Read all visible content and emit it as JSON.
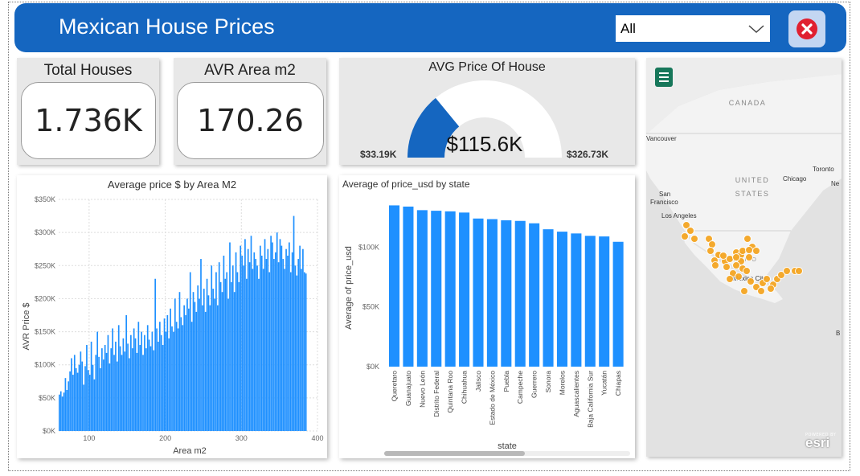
{
  "header": {
    "title": "Mexican House Prices",
    "filter_value": "All",
    "accent_color": "#1566c0",
    "close_icon": "close-circle-icon"
  },
  "kpis": {
    "total_houses": {
      "label": "Total Houses",
      "value": "1.736K"
    },
    "avr_area": {
      "label": "AVR Area m2",
      "value": "170.26"
    }
  },
  "gauge": {
    "title": "AVG Price Of House",
    "value_label": "$115.6K",
    "min_label": "$33.19K",
    "max_label": "$326.73K",
    "value": 115.6,
    "min": 33.19,
    "max": 326.73,
    "fill_color": "#1566c0"
  },
  "map": {
    "labels": [
      "CANADA",
      "Vancouver",
      "Toronto",
      "Chicago",
      "UNITED",
      "STATES",
      "Ne",
      "San",
      "Francisco",
      "Los Angeles",
      "MEXICO",
      "Mexico City",
      "B"
    ],
    "brand": "esri",
    "brand_small": "POWERED BY",
    "menu_icon": "hamburger-menu-icon",
    "marker_color": "#f5a623"
  },
  "chart_data": [
    {
      "type": "bar",
      "title": "Average price $ by Area M2",
      "xlabel": "Area m2",
      "ylabel": "AVR Price $",
      "x_ticks": [
        "100",
        "200",
        "300",
        "400"
      ],
      "y_ticks": [
        "$0K",
        "$50K",
        "$100K",
        "$150K",
        "$200K",
        "$250K",
        "$300K",
        "$350K"
      ],
      "xlim": [
        60,
        400
      ],
      "ylim": [
        0,
        350000
      ],
      "grid": true,
      "color": "#1e90ff",
      "x": [
        60,
        62,
        64,
        66,
        68,
        70,
        72,
        74,
        76,
        78,
        80,
        82,
        84,
        86,
        88,
        90,
        92,
        94,
        96,
        98,
        100,
        102,
        104,
        106,
        108,
        110,
        112,
        114,
        116,
        118,
        120,
        122,
        124,
        126,
        128,
        130,
        132,
        134,
        136,
        138,
        140,
        142,
        144,
        146,
        148,
        150,
        152,
        154,
        156,
        158,
        160,
        162,
        164,
        166,
        168,
        170,
        172,
        174,
        176,
        178,
        180,
        182,
        184,
        186,
        188,
        190,
        192,
        194,
        196,
        198,
        200,
        202,
        204,
        206,
        208,
        210,
        212,
        214,
        216,
        218,
        220,
        222,
        224,
        226,
        228,
        230,
        232,
        234,
        236,
        238,
        240,
        242,
        244,
        246,
        248,
        250,
        252,
        254,
        256,
        258,
        260,
        262,
        264,
        266,
        268,
        270,
        272,
        274,
        276,
        278,
        280,
        282,
        284,
        286,
        288,
        290,
        292,
        294,
        296,
        298,
        300,
        302,
        304,
        306,
        308,
        310,
        312,
        314,
        316,
        318,
        320,
        322,
        324,
        326,
        328,
        330,
        332,
        334,
        336,
        338,
        340,
        342,
        344,
        346,
        348,
        350,
        352,
        354,
        356,
        358,
        360,
        362,
        364,
        366,
        368,
        370,
        372,
        374,
        376,
        378,
        380,
        382,
        384
      ],
      "values": [
        55000,
        60000,
        52000,
        58000,
        80000,
        62000,
        75000,
        90000,
        110000,
        85000,
        115000,
        95000,
        88000,
        100000,
        120000,
        105000,
        70000,
        98000,
        130000,
        92000,
        85000,
        135000,
        100000,
        78000,
        115000,
        150000,
        112000,
        95000,
        125000,
        108000,
        130000,
        118000,
        145000,
        102000,
        125000,
        155000,
        115000,
        135000,
        105000,
        160000,
        128000,
        115000,
        140000,
        120000,
        175000,
        132000,
        110000,
        145000,
        125000,
        155000,
        140000,
        118000,
        165000,
        130000,
        150000,
        115000,
        145000,
        125000,
        160000,
        138000,
        128000,
        150000,
        122000,
        230000,
        155000,
        135000,
        165000,
        145000,
        130000,
        170000,
        150000,
        175000,
        140000,
        185000,
        158000,
        150000,
        200000,
        165000,
        155000,
        210000,
        172000,
        160000,
        190000,
        175000,
        200000,
        185000,
        240000,
        165000,
        210000,
        195000,
        180000,
        220000,
        200000,
        260000,
        190000,
        215000,
        180000,
        230000,
        205000,
        190000,
        250000,
        215000,
        200000,
        240000,
        190000,
        255000,
        225000,
        210000,
        265000,
        230000,
        240000,
        200000,
        285000,
        225000,
        250000,
        210000,
        270000,
        240000,
        225000,
        280000,
        265000,
        250000,
        290000,
        230000,
        275000,
        255000,
        295000,
        245000,
        270000,
        260000,
        250000,
        230000,
        280000,
        265000,
        245000,
        290000,
        260000,
        275000,
        240000,
        295000,
        285000,
        260000,
        270000,
        300000,
        255000,
        290000,
        280000,
        260000,
        245000,
        275000,
        265000,
        285000,
        240000,
        270000,
        325000,
        250000,
        235000,
        260000,
        280000,
        245000,
        275000,
        240000,
        238000
      ]
    },
    {
      "type": "bar",
      "title": "Average of price_usd by state",
      "xlabel": "state",
      "ylabel": "Average of price_usd",
      "y_ticks": [
        "$0K",
        "$50K",
        "$100K"
      ],
      "ylim": [
        0,
        140000
      ],
      "grid": false,
      "color": "#1e90ff",
      "categories": [
        "Queretaro",
        "Guanajuato",
        "Nuevo León",
        "Distrito Federal",
        "Quintana Roo",
        "Chihuahua",
        "Jalisco",
        "Estado de México",
        "Puebla",
        "Campeche",
        "Guerrero",
        "Sonora",
        "Morelos",
        "Aguascalientes",
        "Baja California Sur",
        "Yucatán",
        "Chiapas"
      ],
      "values": [
        135000,
        134000,
        131000,
        130500,
        130000,
        129000,
        124000,
        123500,
        122500,
        122000,
        120000,
        115000,
        113000,
        111500,
        109500,
        109000,
        104500
      ]
    }
  ]
}
